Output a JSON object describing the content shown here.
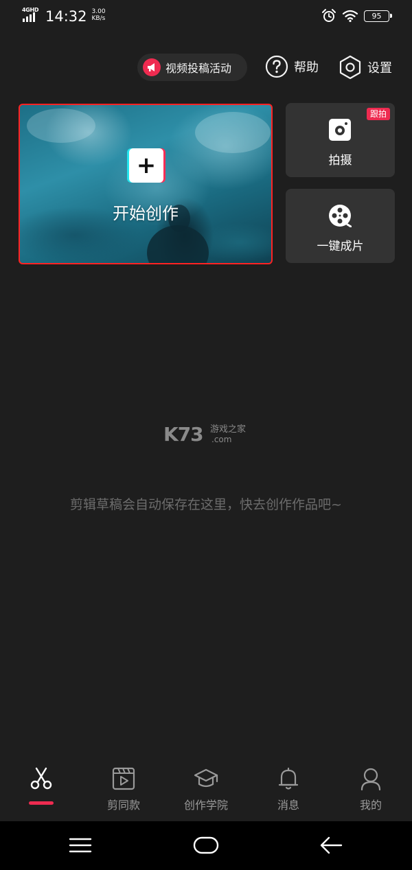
{
  "status_bar": {
    "network": "4GHD",
    "time": "14:32",
    "speed_value": "3.00",
    "speed_unit": "KB/s",
    "battery": "95"
  },
  "header": {
    "promo_label": "视频投稿活动",
    "help_label": "帮助",
    "settings_label": "设置"
  },
  "create_card": {
    "label": "开始创作",
    "plus": "+"
  },
  "side_cards": {
    "camera_label": "拍摄",
    "camera_badge": "跟拍",
    "oneclick_label": "一键成片"
  },
  "watermark": {
    "main": "K73",
    "cn": "游戏之家",
    "com": ".com"
  },
  "empty_state": {
    "message": "剪辑草稿会自动保存在这里，快去创作作品吧~"
  },
  "tabs": [
    {
      "label": "",
      "icon": "scissors-icon",
      "active": true
    },
    {
      "label": "剪同款",
      "icon": "clapper-icon"
    },
    {
      "label": "创作学院",
      "icon": "graduation-cap-icon"
    },
    {
      "label": "消息",
      "icon": "bell-icon"
    },
    {
      "label": "我的",
      "icon": "person-icon"
    }
  ],
  "colors": {
    "background": "#1e1e1e",
    "accent": "#ee2b50",
    "card": "#333333",
    "muted_text": "#6c6c6c"
  }
}
